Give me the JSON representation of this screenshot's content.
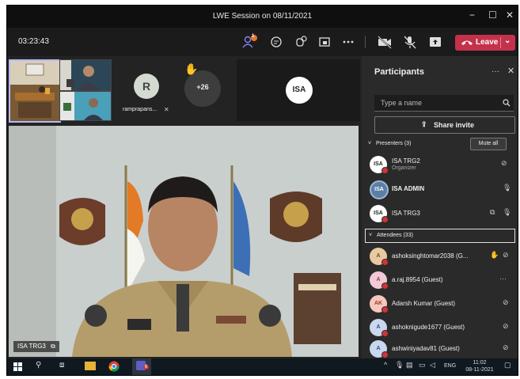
{
  "window": {
    "title": "LWE Session on 08/11/2021",
    "minimize_label": "−",
    "maximize_label": "☐",
    "close_label": "✕"
  },
  "toolbar": {
    "timer": "03:23:43",
    "people_badge": "1",
    "leave_label": "Leave"
  },
  "thumbnails": {
    "avatar_initial": "R",
    "avatar_name": "ramprapans...",
    "overflow_count": "+26",
    "isa_label": "ISA"
  },
  "main_video": {
    "speaker_name": "ISA TRG3"
  },
  "panel": {
    "title": "Participants",
    "search_placeholder": "Type a name",
    "share_invite_label": "Share invite",
    "presenters_label": "Presenters (3)",
    "mute_all_label": "Mute all",
    "attendees_label": "Attendees (33)",
    "presenters": [
      {
        "initials": "ISA",
        "name": "ISA TRG2",
        "role": "Organizer"
      },
      {
        "initials": "ISA",
        "name": "ISA ADMIN",
        "role": ""
      },
      {
        "initials": "ISA",
        "name": "ISA TRG3",
        "role": ""
      }
    ],
    "attendees": [
      {
        "initials": "A",
        "name": "ashoksinghtomar2038 (G..."
      },
      {
        "initials": "A",
        "name": "a.raj.8954 (Guest)"
      },
      {
        "initials": "AK",
        "name": "Adarsh Kumar (Guest)"
      },
      {
        "initials": "A",
        "name": "ashoknigude1677 (Guest)"
      },
      {
        "initials": "A",
        "name": "ashwiniyadav81 (Guest)"
      }
    ]
  },
  "taskbar": {
    "lang": "ENG",
    "time": "11:02",
    "date": "08-11-2021",
    "teams_badge": "6"
  }
}
